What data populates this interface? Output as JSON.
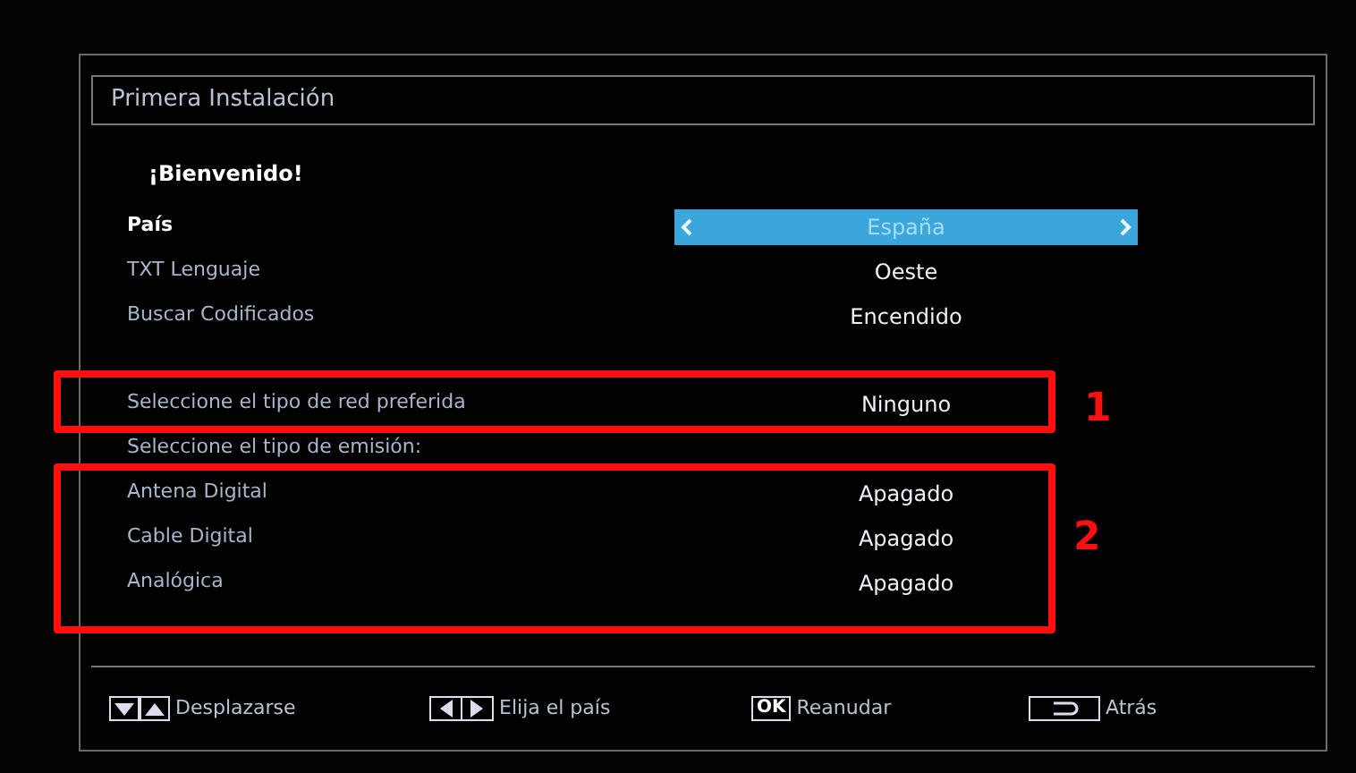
{
  "window": {
    "title": "Primera Instalación"
  },
  "greeting": "¡Bienvenido!",
  "rows": [
    {
      "kind": "setting",
      "label": "País",
      "value": "España",
      "selected": true
    },
    {
      "kind": "setting",
      "label": "TXT Lenguaje",
      "value": "Oeste",
      "selected": false
    },
    {
      "kind": "setting",
      "label": "Buscar Codificados",
      "value": "Encendido",
      "selected": false
    },
    {
      "kind": "gap"
    },
    {
      "kind": "setting",
      "label": "Seleccione el tipo de red preferida",
      "value": "Ninguno",
      "selected": false
    },
    {
      "kind": "heading",
      "label": "Seleccione el tipo de emisión:"
    },
    {
      "kind": "setting",
      "label": "Antena Digital",
      "value": "Apagado",
      "selected": false
    },
    {
      "kind": "setting",
      "label": "Cable Digital",
      "value": "Apagado",
      "selected": false
    },
    {
      "kind": "setting",
      "label": "Analógica",
      "value": "Apagado",
      "selected": false
    }
  ],
  "hints": [
    {
      "kind": "updown",
      "label": "Desplazarse"
    },
    {
      "kind": "leftright",
      "label": "Elija el país"
    },
    {
      "kind": "ok",
      "key": "OK",
      "label": "Reanudar"
    },
    {
      "kind": "back",
      "label": "Atrás"
    }
  ],
  "annotations": [
    {
      "number": "1"
    },
    {
      "number": "2"
    }
  ]
}
